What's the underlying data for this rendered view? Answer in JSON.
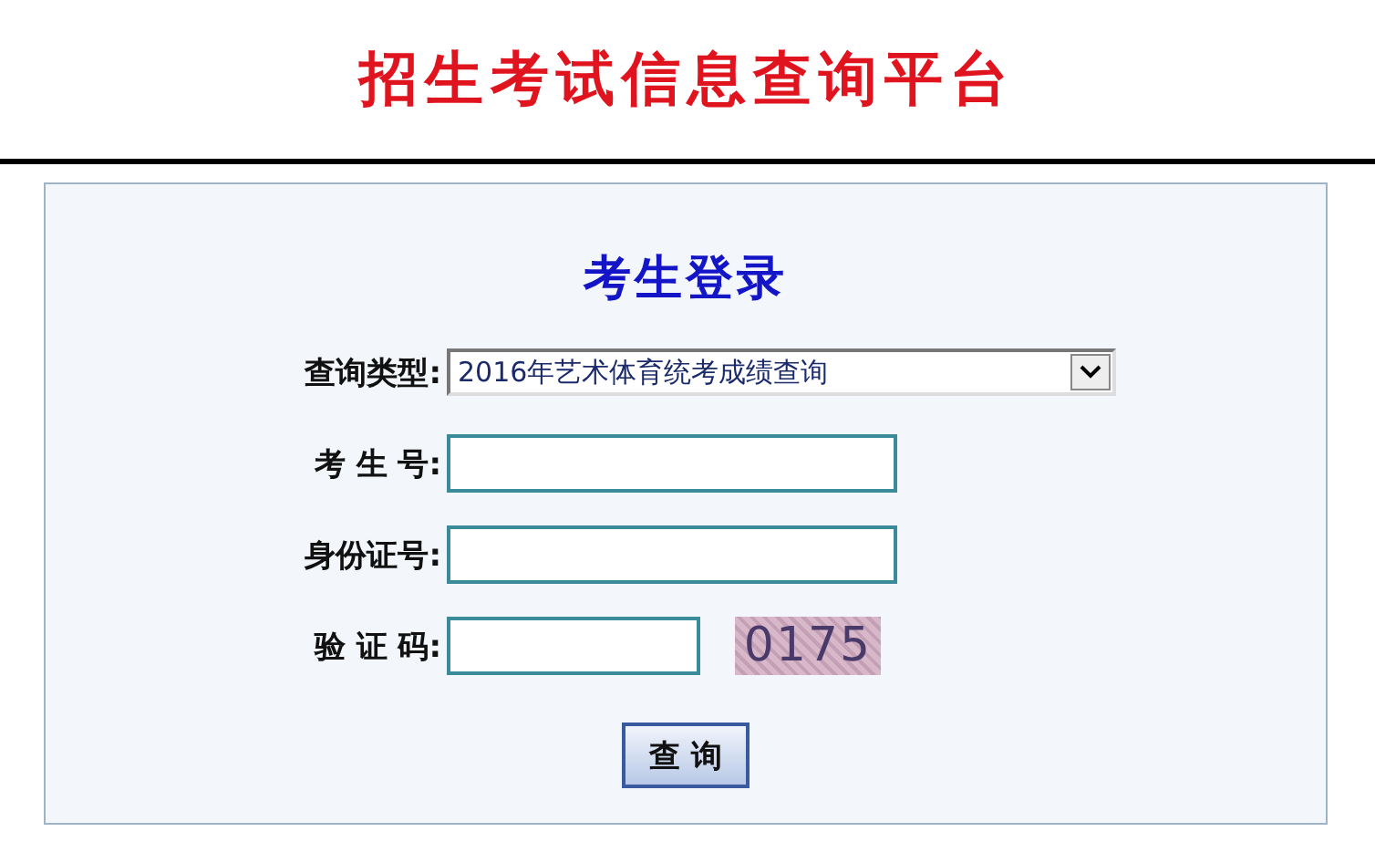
{
  "header": {
    "title": "招生考试信息查询平台"
  },
  "login": {
    "title": "考生登录",
    "fields": [
      {
        "kind": "select",
        "label": "查询类型:",
        "value": "2016年艺术体育统考成绩查询"
      },
      {
        "kind": "input",
        "label": "考 生 号:"
      },
      {
        "kind": "input",
        "label": "身份证号:"
      },
      {
        "kind": "captcha",
        "label": "验 证 码:",
        "captcha": "0175"
      }
    ],
    "button": "查 询"
  }
}
